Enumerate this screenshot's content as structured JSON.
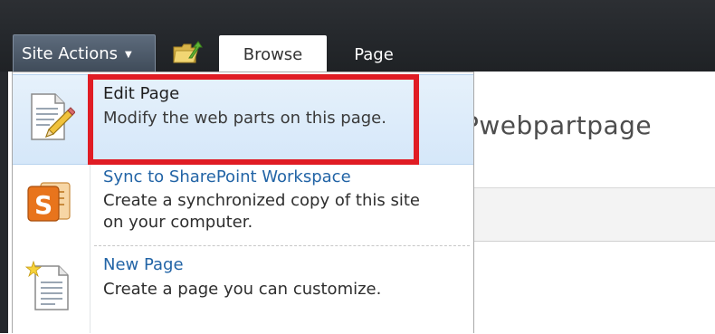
{
  "ribbon": {
    "site_actions_label": "Site Actions",
    "tabs": [
      {
        "label": "Browse",
        "selected": true
      },
      {
        "label": "Page",
        "selected": false
      }
    ]
  },
  "page": {
    "title_partial": "Pwebpartpage"
  },
  "menu": {
    "items": [
      {
        "title": "Edit Page",
        "description": "Modify the web parts on this page.",
        "icon": "edit-page-icon",
        "highlighted": true
      },
      {
        "title": "Sync to SharePoint Workspace",
        "description": "Create a synchronized copy of this site on your computer.",
        "icon": "sharepoint-workspace-icon"
      },
      {
        "title": "New Page",
        "description": "Create a page you can customize.",
        "icon": "new-page-icon"
      }
    ]
  },
  "colors": {
    "ribbon_bg": "#24272b",
    "menu_title": "#2264a6",
    "highlight_bg": "#d5e7f9",
    "annotation_red": "#e01c24"
  }
}
